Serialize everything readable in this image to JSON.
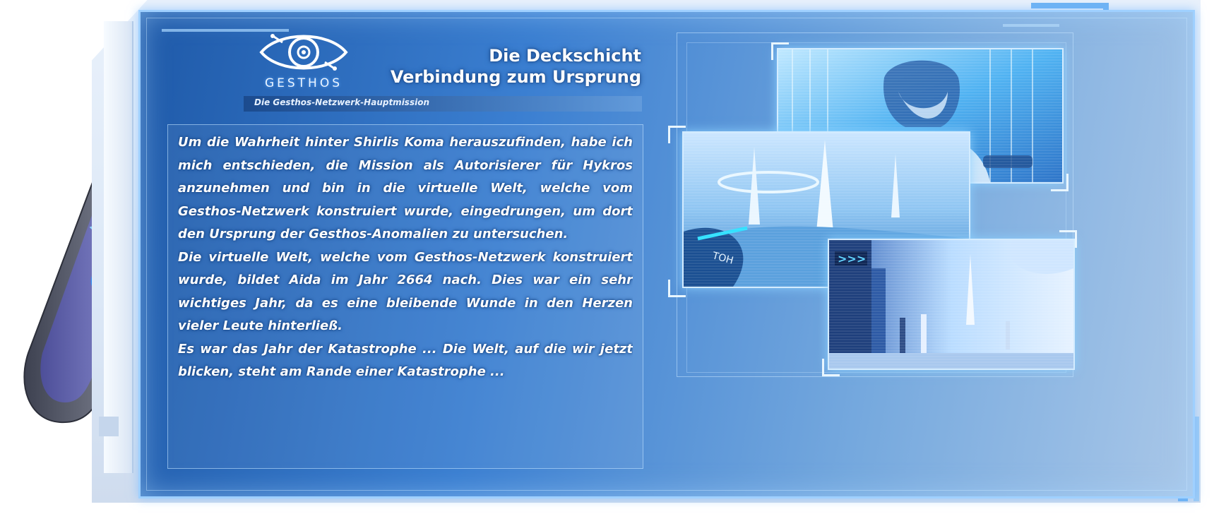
{
  "header": {
    "logo_text": "GESTHOS",
    "title_line1": "Die Deckschicht",
    "title_line2": "Verbindung zum Ursprung",
    "subtitle": "Die Gesthos-Netzwerk-Hauptmission"
  },
  "body": {
    "paragraph1": "Um die Wahrheit hinter Shirlis Koma herauszufinden, habe ich mich entschieden, die Mission als Autorisierer für Hykros anzunehmen und bin in die virtuelle Welt, welche vom Gesthos-Netzwerk konstruiert wurde, eingedrungen, um dort den Ursprung der Gesthos-Anomalien zu untersuchen.",
    "paragraph2": "Die virtuelle Welt, welche vom Gesthos-Netzwerk konstruiert wurde, bildet Aida im Jahr 2664 nach. Dies war ein sehr wichtiges Jahr, da es eine bleibende Wunde in den Herzen vieler Leute hinterließ.",
    "paragraph3": "Es war das Jahr der Katastrophe ... Die Welt, auf die wir jetzt blicken, steht am Rande einer Katastrophe ..."
  },
  "collage": {
    "sign_text": "TOH",
    "arrow_text": ">>>"
  },
  "colors": {
    "screen_dark": "#1f5aa9",
    "screen_light": "#a9c7e8",
    "glow": "#9fd0ff",
    "text": "#ffffff"
  },
  "icons": [
    "eye-logo-icon",
    "fish-charm-icon",
    "strap-icon"
  ]
}
